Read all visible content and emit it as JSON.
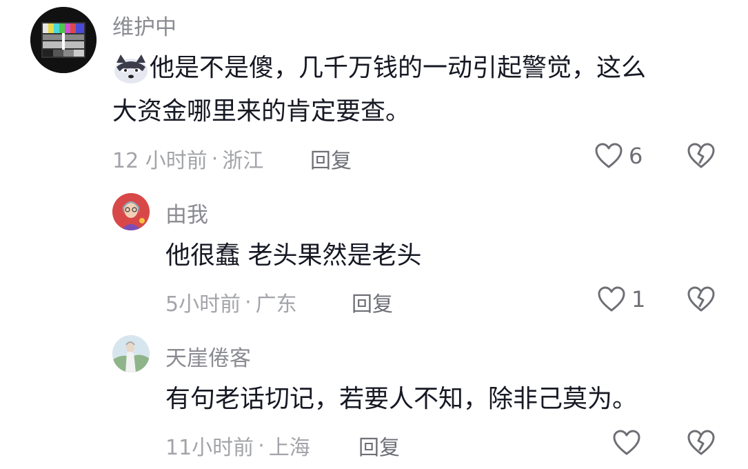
{
  "comments": [
    {
      "username": "维护中",
      "avatar": "test-pattern-avatar",
      "emoji": "wolf-face-emoji",
      "line1": "他是不是傻，几千万钱的一动引起警觉，这么",
      "line2": "大资金哪里来的肯定要查。",
      "time": "12 小时前",
      "separator": "·",
      "location": "浙江",
      "reply": "回复",
      "likes": "6"
    },
    {
      "username": "由我",
      "avatar": "cartoon-girl-avatar",
      "text": "他很蠢 老头果然是老头",
      "time": "5小时前",
      "separator": "·",
      "location": "广东",
      "reply": "回复",
      "likes": "1"
    },
    {
      "username": "天崖倦客",
      "avatar": "landscape-person-avatar",
      "text": "有句老话切记，若要人不知，除非己莫为。",
      "time": "11小时前",
      "separator": "·",
      "location": "上海",
      "reply": "回复",
      "likes": ""
    }
  ],
  "colors": {
    "text": "#161823",
    "secondary": "#a3a4a9",
    "name": "#8a8b91"
  }
}
